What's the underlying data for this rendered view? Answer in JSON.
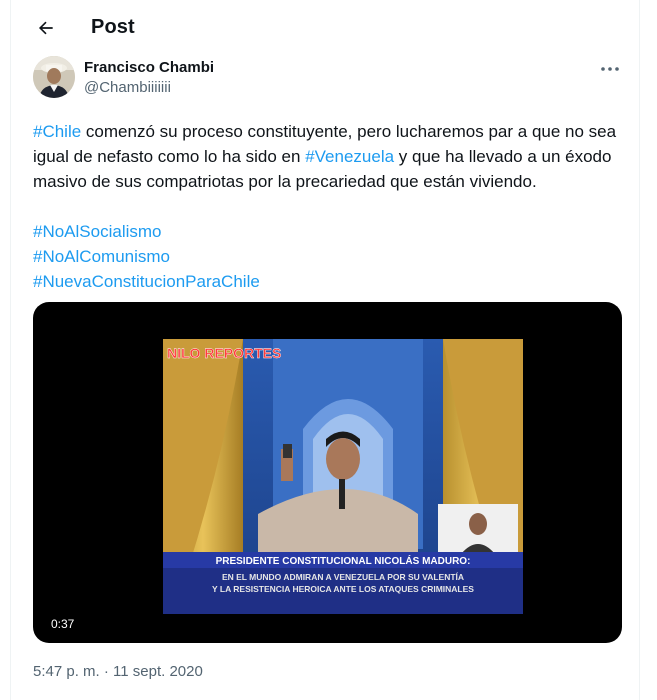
{
  "header": {
    "title": "Post"
  },
  "author": {
    "name": "Francisco Chambi",
    "handle": "@Chambiiiiiii"
  },
  "tweet": {
    "para1": [
      {
        "text": "#Chile",
        "hashtag": true
      },
      {
        "text": " comenzó su proceso constituyente, pero lucharemos par a que no sea igual de nefasto como lo ha sido en ",
        "hashtag": false
      },
      {
        "text": "#Venezuela",
        "hashtag": true
      },
      {
        "text": " y que ha llevado a un éxodo masivo de sus compatriotas por la precariedad que están viviendo.",
        "hashtag": false
      }
    ],
    "hashtags": [
      "#NoAlSocialismo",
      "#NoAlComunismo",
      "#NuevaConstitucionParaChile"
    ]
  },
  "media": {
    "duration": "0:37",
    "watermark": "NILO REPORTES",
    "caption_title": "PRESIDENTE CONSTITUCIONAL NICOLÁS MADURO:",
    "caption_line1": "EN EL MUNDO ADMIRAN A VENEZUELA POR SU VALENTÍA",
    "caption_line2": "Y LA RESISTENCIA HEROICA ANTE LOS ATAQUES CRIMINALES"
  },
  "meta": {
    "timestamp": "5:47 p. m. · 11 sept. 2020"
  },
  "colors": {
    "accent": "#1d9bf0",
    "text": "#0f1419",
    "secondary": "#536471"
  },
  "icons": {
    "back": "arrow-left-icon",
    "more": "more-horizontal-icon"
  }
}
